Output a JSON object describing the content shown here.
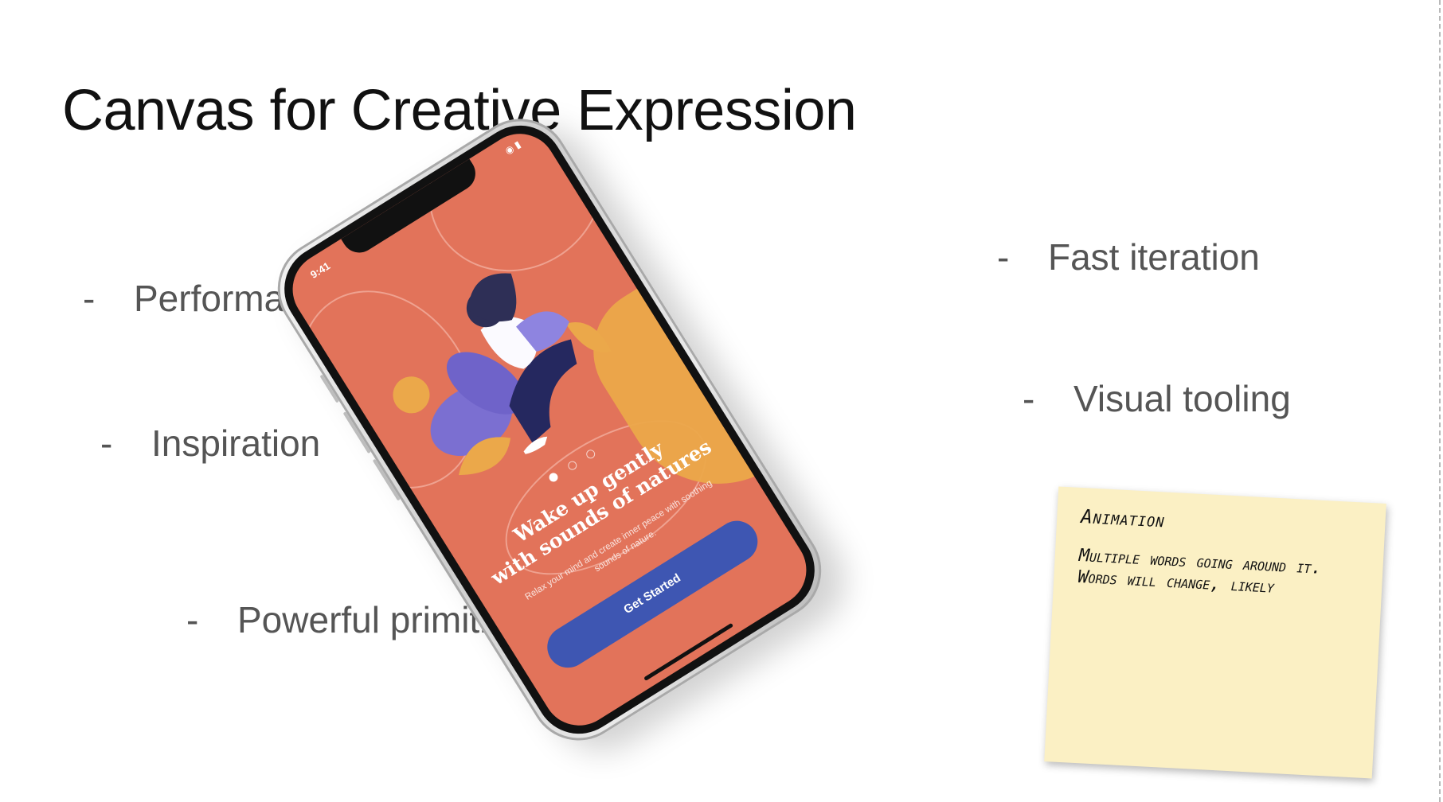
{
  "slide": {
    "title": "Canvas for Creative Expression",
    "bullets": [
      {
        "dash": "-",
        "text": "Performance"
      },
      {
        "dash": "-",
        "text": "Inspiration"
      },
      {
        "dash": "-",
        "text": "Powerful primitives"
      },
      {
        "dash": "-",
        "text": "Fast iteration"
      },
      {
        "dash": "-",
        "text": "Visual tooling"
      }
    ]
  },
  "phone": {
    "status_time": "9:41",
    "headline_line1": "Wake up gently",
    "headline_line2": "with sounds of natures",
    "subtext": "Relax your mind and create inner peace with soothing sounds of nature.",
    "cta_label": "Get Started",
    "pager": {
      "total": 3,
      "active": 1
    },
    "colors": {
      "background": "#e2735a",
      "accent": "#eba84a",
      "button": "#3e56b2"
    }
  },
  "sticky_note": {
    "title": "Animation",
    "body": "Multiple words going around it. Words will change, likely"
  }
}
